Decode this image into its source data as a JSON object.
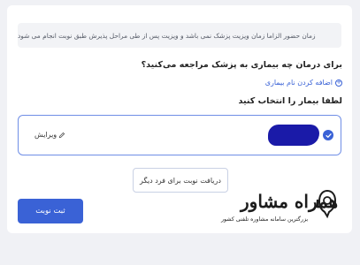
{
  "notice": {
    "text": "زمان حضور الزاما زمان ویزیت پزشک نمی باشد و ویزیت پس از طی مراحل پذیرش طبق نوبت انجام می شود"
  },
  "question": {
    "text": "برای درمان چه بیماری به پزشک مراجعه می‌کنید؟"
  },
  "add_disease": {
    "label": "اضافه کردن نام بیماری",
    "icon": "plus-circle-icon"
  },
  "patient_section": {
    "title": "لطفا بیمار را انتخاب کنید",
    "patient": {
      "selected": true,
      "name_redacted": true,
      "edit_label": "ویرایش"
    }
  },
  "buttons": {
    "other_person": "دریافت نوبت برای فرد دیگر",
    "submit": "ثبت نوبت"
  },
  "watermark": {
    "main": "همراه مشاور",
    "sub": "بزرگترین سامانه مشاوره تلفنی کشور"
  },
  "colors": {
    "accent": "#3a62d6",
    "redaction": "#1a1aa8",
    "notice_bg": "#f2f3f6",
    "page_bg": "#f0f1f5"
  }
}
